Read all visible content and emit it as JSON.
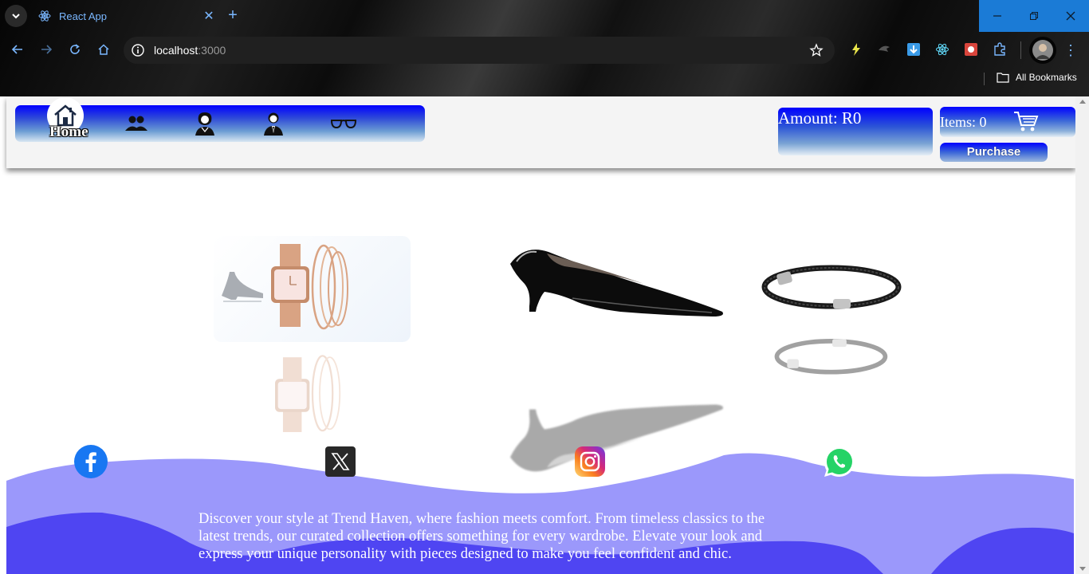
{
  "browser": {
    "tab_title": "React App",
    "url_host": "localhost",
    "url_port": ":3000",
    "bookmarks_label": "All Bookmarks"
  },
  "header": {
    "nav": {
      "home_label": "Home",
      "icons": [
        "home-icon",
        "group-icon",
        "women-icon",
        "men-icon",
        "glasses-icon"
      ]
    },
    "amount_label": "Amount: R0",
    "items_label": "Items: 0",
    "purchase_label": "Purchase"
  },
  "products": [
    "watch-set",
    "black-pump-shoe",
    "cable-bracelet"
  ],
  "footer": {
    "social": [
      "facebook-icon",
      "x-icon",
      "instagram-icon",
      "whatsapp-icon"
    ],
    "blurb": "Discover your style at Trend Haven, where fashion meets comfort. From timeless classics to the latest trends, our curated collection offers something for every wardrobe. Elevate your look and express your unique personality with pieces designed to make you feel confident and chic."
  },
  "colors": {
    "accent_blue": "#0000ff",
    "wave_light": "#9b98fb",
    "wave_dark": "#4f45f2",
    "chrome_tab_text": "#7ab7ff",
    "window_button": "#1b7bd6"
  }
}
